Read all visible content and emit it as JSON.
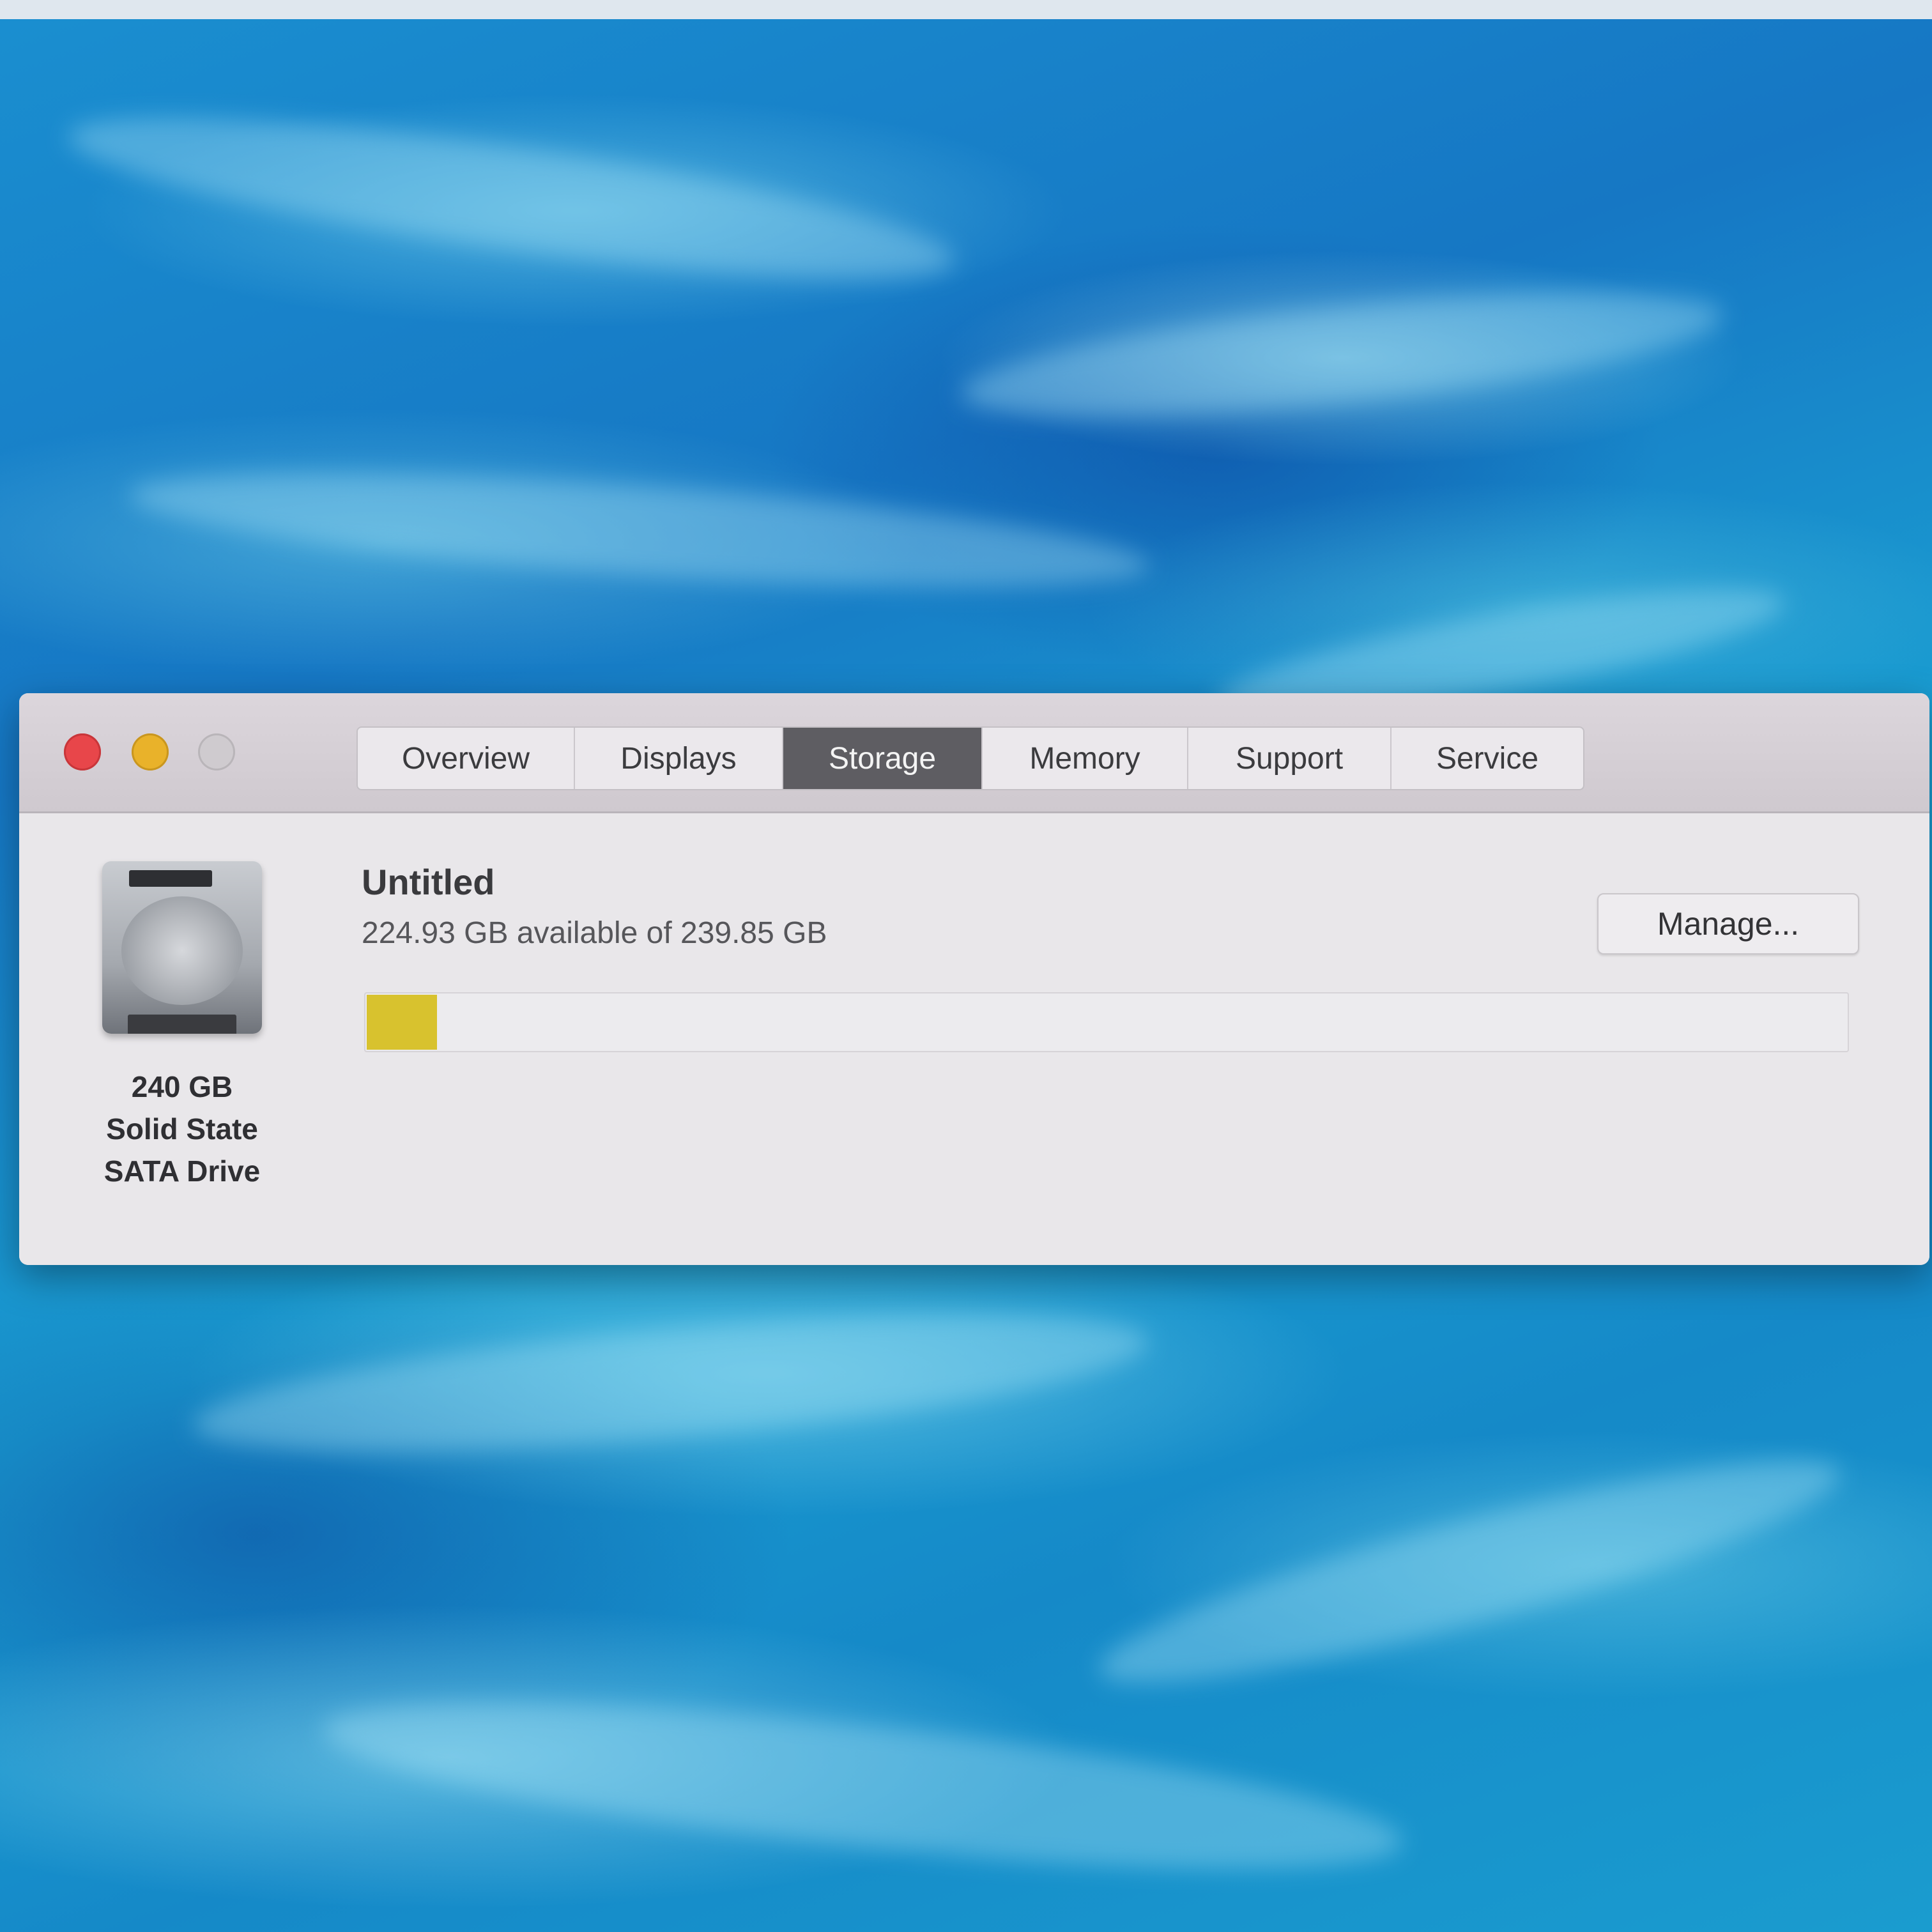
{
  "window": {
    "tabs": [
      {
        "label": "Overview",
        "active": false
      },
      {
        "label": "Displays",
        "active": false
      },
      {
        "label": "Storage",
        "active": true
      },
      {
        "label": "Memory",
        "active": false
      },
      {
        "label": "Support",
        "active": false
      },
      {
        "label": "Service",
        "active": false
      }
    ]
  },
  "storage": {
    "drive": {
      "icon": "hard-drive-icon",
      "caption_line1": "240 GB",
      "caption_line2": "Solid State",
      "caption_line3": "SATA Drive"
    },
    "volume": {
      "name": "Untitled",
      "availability": "224.93 GB available of 239.85 GB",
      "used_fraction": 0.026,
      "used_color": "#d8c22e"
    },
    "manage_label": "Manage..."
  },
  "colors": {
    "close": "#e8464a",
    "minimize": "#e9b22a",
    "zoom": "#cfcbcf",
    "active_tab": "#5e5d62"
  }
}
